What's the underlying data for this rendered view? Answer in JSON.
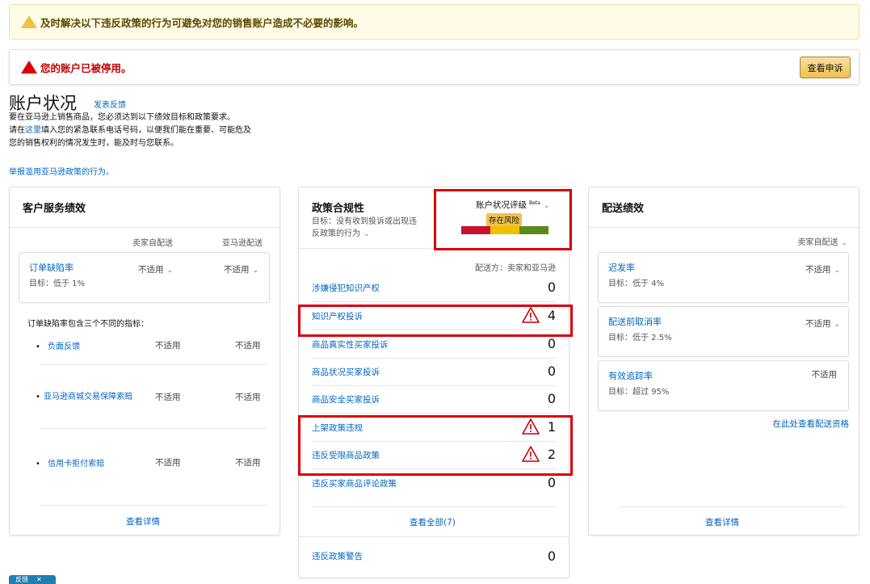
{
  "banners": {
    "warning_text": "及时解决以下违反政策的行为可避免对您的销售账户造成不必要的影响。",
    "error_text": "您的账户已被停用。",
    "appeal_button": "查看申诉"
  },
  "header": {
    "title": "账户状况",
    "feedback_link": "发表反馈",
    "intro_line1": "要在亚马逊上销售商品，您必须达到以下绩效目标和政策要求。",
    "intro_line2_prefix": "请在",
    "intro_line2_link": "这里",
    "intro_line2_suffix": "填入您的紧急联系电话号码，以便我们能在重要、可能危及",
    "intro_line3": "您的销售权利的情况发生时，能及时与您联系。",
    "report_link": "举报滥用亚马逊政策的行为。"
  },
  "customer_service": {
    "title": "客户服务绩效",
    "col_seller": "卖家自配送",
    "col_amazon": "亚马逊配送",
    "odr": {
      "label": "订单缺陷率",
      "target": "目标：低于 1%",
      "seller": "不适用",
      "amazon": "不适用"
    },
    "note": "订单缺陷率包含三个不同的指标：",
    "metrics": [
      {
        "label": "负面反馈",
        "seller": "不适用",
        "amazon": "不适用"
      },
      {
        "label": "亚马逊商城交易保障索赔",
        "seller": "不适用",
        "amazon": "不适用"
      },
      {
        "label": "信用卡拒付索赔",
        "seller": "不适用",
        "amazon": "不适用"
      }
    ],
    "view_details": "查看详情"
  },
  "policy": {
    "title": "政策合规性",
    "target_line1": "目标：没有收到投诉或出现违",
    "target_line2": "反政策的行为",
    "rating_label": "账户状况评级",
    "beta": "Beta",
    "risk_badge": "存在风险",
    "risk_colors": [
      "#c7112f",
      "#f0c000",
      "#5a8a1c"
    ],
    "fulfilled_by": "配送方：卖家和亚马逊",
    "rows": [
      {
        "label": "涉嫌侵犯知识产权",
        "value": "0",
        "alert": false
      },
      {
        "label": "知识产权投诉",
        "value": "4",
        "alert": true
      },
      {
        "label": "商品真实性买家投诉",
        "value": "0",
        "alert": false
      },
      {
        "label": "商品状况买家投诉",
        "value": "0",
        "alert": false
      },
      {
        "label": "商品安全买家投诉",
        "value": "0",
        "alert": false
      },
      {
        "label": "上架政策违规",
        "value": "1",
        "alert": true
      },
      {
        "label": "违反受限商品政策",
        "value": "2",
        "alert": true
      },
      {
        "label": "违反买家商品评论政策",
        "value": "0",
        "alert": false
      }
    ],
    "view_all": "查看全部(7)",
    "warnings": {
      "label": "违反政策警告",
      "value": "0"
    }
  },
  "shipping": {
    "title": "配送绩效",
    "filter": "卖家自配送",
    "metrics": [
      {
        "label": "迟发率",
        "target": "目标：低于 4%",
        "value": "不适用"
      },
      {
        "label": "配送前取消率",
        "target": "目标：低于 2.5%",
        "value": "不适用"
      },
      {
        "label": "有效追踪率",
        "target": "目标：超过 95%",
        "value": "不适用"
      }
    ],
    "eligibility_link": "在此处查看配送资格",
    "view_details": "查看详情"
  },
  "feedback_tab": "反馈"
}
